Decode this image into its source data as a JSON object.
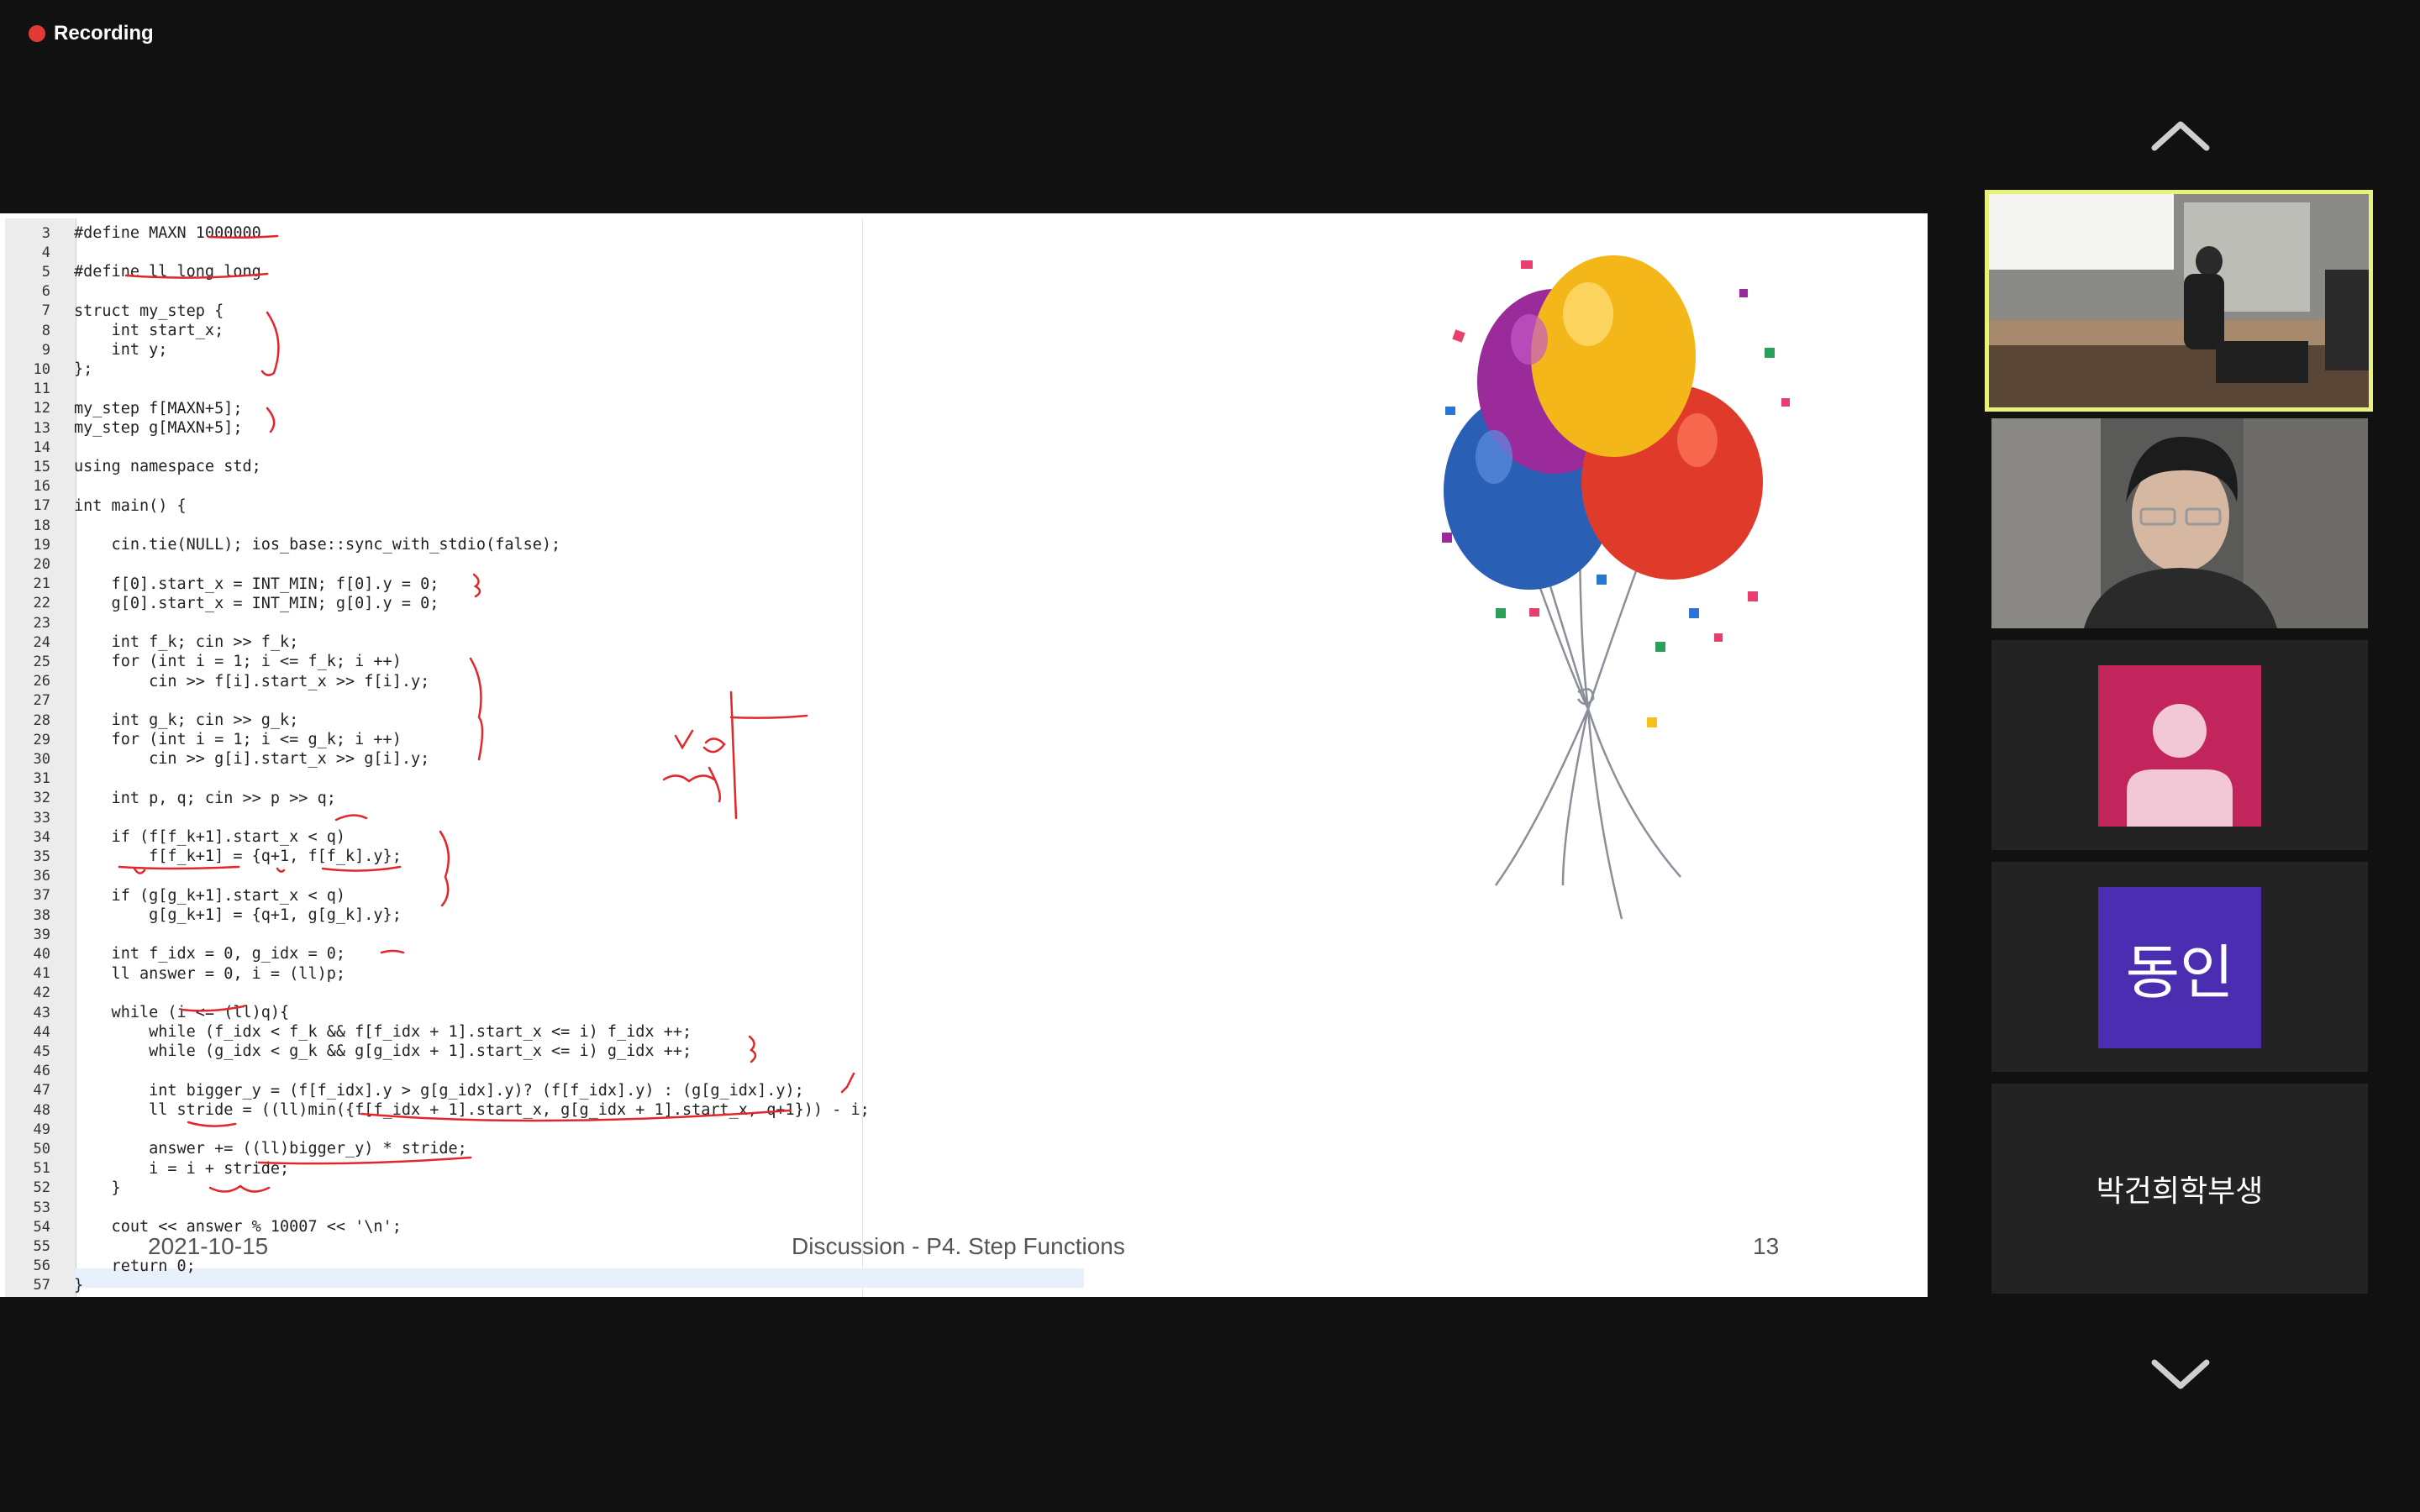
{
  "recording": {
    "label": "Recording",
    "color": "#e53935"
  },
  "slide": {
    "footer_date": "2021-10-15",
    "footer_title": "Discussion - P4. Step Functions",
    "footer_page": "13",
    "code_lines": [
      {
        "n": "3",
        "t": "#define MAXN 1000000"
      },
      {
        "n": "4",
        "t": ""
      },
      {
        "n": "5",
        "t": "#define ll long long"
      },
      {
        "n": "6",
        "t": ""
      },
      {
        "n": "7",
        "t": "struct my_step {"
      },
      {
        "n": "8",
        "t": "    int start_x;"
      },
      {
        "n": "9",
        "t": "    int y;"
      },
      {
        "n": "10",
        "t": "};"
      },
      {
        "n": "11",
        "t": ""
      },
      {
        "n": "12",
        "t": "my_step f[MAXN+5];"
      },
      {
        "n": "13",
        "t": "my_step g[MAXN+5];"
      },
      {
        "n": "14",
        "t": ""
      },
      {
        "n": "15",
        "t": "using namespace std;"
      },
      {
        "n": "16",
        "t": ""
      },
      {
        "n": "17",
        "t": "int main() {"
      },
      {
        "n": "18",
        "t": ""
      },
      {
        "n": "19",
        "t": "    cin.tie(NULL); ios_base::sync_with_stdio(false);"
      },
      {
        "n": "20",
        "t": ""
      },
      {
        "n": "21",
        "t": "    f[0].start_x = INT_MIN; f[0].y = 0;"
      },
      {
        "n": "22",
        "t": "    g[0].start_x = INT_MIN; g[0].y = 0;"
      },
      {
        "n": "23",
        "t": ""
      },
      {
        "n": "24",
        "t": "    int f_k; cin >> f_k;"
      },
      {
        "n": "25",
        "t": "    for (int i = 1; i <= f_k; i ++)"
      },
      {
        "n": "26",
        "t": "        cin >> f[i].start_x >> f[i].y;"
      },
      {
        "n": "27",
        "t": ""
      },
      {
        "n": "28",
        "t": "    int g_k; cin >> g_k;"
      },
      {
        "n": "29",
        "t": "    for (int i = 1; i <= g_k; i ++)"
      },
      {
        "n": "30",
        "t": "        cin >> g[i].start_x >> g[i].y;"
      },
      {
        "n": "31",
        "t": ""
      },
      {
        "n": "32",
        "t": "    int p, q; cin >> p >> q;"
      },
      {
        "n": "33",
        "t": ""
      },
      {
        "n": "34",
        "t": "    if (f[f_k+1].start_x < q)"
      },
      {
        "n": "35",
        "t": "        f[f_k+1] = {q+1, f[f_k].y};"
      },
      {
        "n": "36",
        "t": ""
      },
      {
        "n": "37",
        "t": "    if (g[g_k+1].start_x < q)"
      },
      {
        "n": "38",
        "t": "        g[g_k+1] = {q+1, g[g_k].y};"
      },
      {
        "n": "39",
        "t": ""
      },
      {
        "n": "40",
        "t": "    int f_idx = 0, g_idx = 0;"
      },
      {
        "n": "41",
        "t": "    ll answer = 0, i = (ll)p;"
      },
      {
        "n": "42",
        "t": ""
      },
      {
        "n": "43",
        "t": "    while (i <= (ll)q){"
      },
      {
        "n": "44",
        "t": "        while (f_idx < f_k && f[f_idx + 1].start_x <= i) f_idx ++;"
      },
      {
        "n": "45",
        "t": "        while (g_idx < g_k && g[g_idx + 1].start_x <= i) g_idx ++;"
      },
      {
        "n": "46",
        "t": ""
      },
      {
        "n": "47",
        "t": "        int bigger_y = (f[f_idx].y > g[g_idx].y)? (f[f_idx].y) : (g[g_idx].y);"
      },
      {
        "n": "48",
        "t": "        ll stride = ((ll)min({f[f_idx + 1].start_x, g[g_idx + 1].start_x, q+1})) - i;"
      },
      {
        "n": "49",
        "t": ""
      },
      {
        "n": "50",
        "t": "        answer += ((ll)bigger_y) * stride;"
      },
      {
        "n": "51",
        "t": "        i = i + stride;"
      },
      {
        "n": "52",
        "t": "    }"
      },
      {
        "n": "53",
        "t": "    "
      },
      {
        "n": "54",
        "t": "    cout << answer % 10007 << '\\n';"
      },
      {
        "n": "55",
        "t": ""
      },
      {
        "n": "56",
        "t": "    return 0;"
      },
      {
        "n": "57",
        "t": "}"
      }
    ]
  },
  "participants": {
    "p3_initial": "",
    "p3_color": "#c2255c",
    "p4_initial": "동인",
    "p4_color": "#4a2db0",
    "p5_name": "박건희학부생",
    "active_border": "#e7f27a"
  },
  "nav": {
    "up_icon": "chevron-up-icon",
    "down_icon": "chevron-down-icon"
  }
}
